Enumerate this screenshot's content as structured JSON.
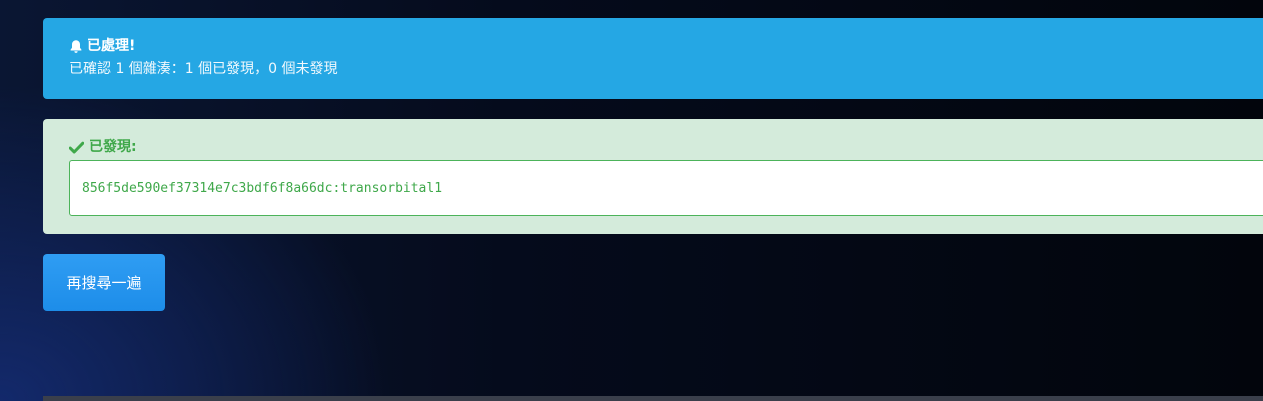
{
  "alert": {
    "icon": "bell-icon",
    "title": "已處理!",
    "message": "已確認 1 個雜湊：1 個已發現，0 個未發現",
    "bg_color": "#25a7e4"
  },
  "found": {
    "icon": "check-icon",
    "title": "已發現:",
    "result": "856f5de590ef37314e7c3bdf6f8a66dc:transorbital1",
    "accent_color": "#3fa84a"
  },
  "actions": {
    "search_again_label": "再搜尋一遍"
  }
}
